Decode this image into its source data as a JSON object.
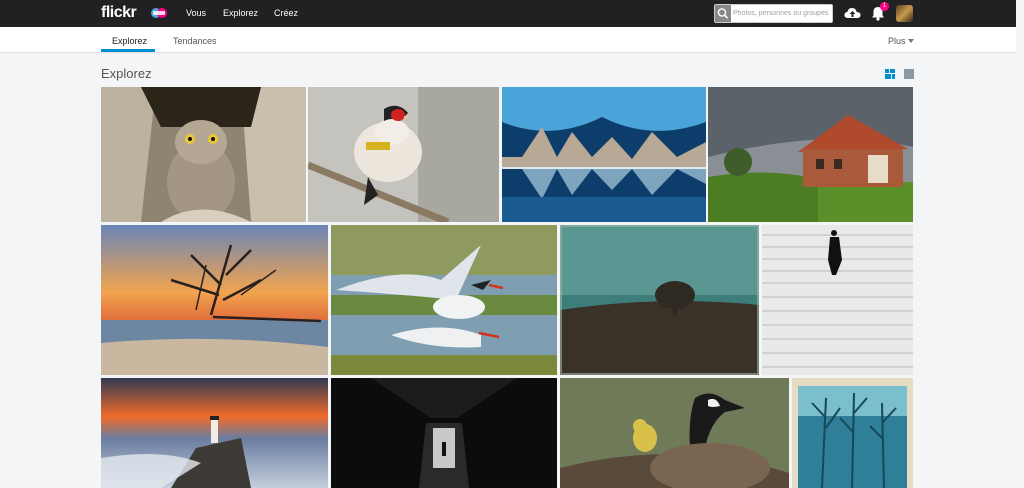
{
  "header": {
    "logo": "flickr",
    "nav": [
      "Vous",
      "Explorez",
      "Créez"
    ],
    "search_placeholder": "Photos, personnes ou groupes",
    "notification_count": "1",
    "icons": [
      "flickr-pro-icon",
      "search-icon",
      "upload-cloud-icon",
      "bell-icon",
      "avatar"
    ]
  },
  "subnav": {
    "tabs": [
      "Explorez",
      "Tendances"
    ],
    "active_tab": "Explorez",
    "more_label": "Plus"
  },
  "page": {
    "title": "Explorez",
    "view_modes": [
      "justified-view-icon",
      "single-view-icon"
    ],
    "active_view": "justified-view-icon"
  },
  "photos": [
    {
      "subject": "owlet-in-tree"
    },
    {
      "subject": "goldfinch-on-branch"
    },
    {
      "subject": "ice-cave-reflection"
    },
    {
      "subject": "red-roof-farmhouse"
    },
    {
      "subject": "sunset-driftwood-tree"
    },
    {
      "subject": "terns-courtship"
    },
    {
      "subject": "lone-tree-field"
    },
    {
      "subject": "silhouette-on-steps"
    },
    {
      "subject": "lighthouse-long-exposure"
    },
    {
      "subject": "dark-tunnel-figure"
    },
    {
      "subject": "goose-with-gosling"
    },
    {
      "subject": "blue-forest-polaroid"
    }
  ],
  "colors": {
    "topbar": "#212124",
    "accent_blue": "#008ecf",
    "notification_pink": "#ff0084",
    "page_background": "#f3f5f6"
  }
}
